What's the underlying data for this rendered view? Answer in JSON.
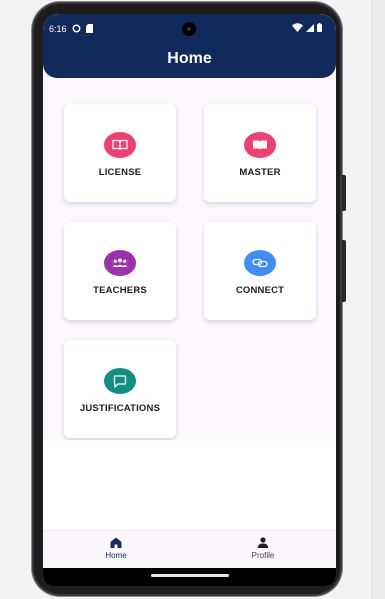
{
  "status_bar": {
    "time": "6:16"
  },
  "app_bar": {
    "title": "Home"
  },
  "cards": [
    {
      "label": "LICENSE",
      "icon": "book-open-icon",
      "color": "#ef3f6f"
    },
    {
      "label": "MASTER",
      "icon": "book-icon",
      "color": "#ef3f6f"
    },
    {
      "label": "TEACHERS",
      "icon": "group-icon",
      "color": "#9b2fae"
    },
    {
      "label": "CONNECT",
      "icon": "link-icon",
      "color": "#3f8ef5"
    },
    {
      "label": "JUSTIFICATIONS",
      "icon": "chat-bubble-icon",
      "color": "#0f8f80"
    }
  ],
  "bottom_nav": {
    "items": [
      {
        "label": "Home",
        "icon": "home-icon",
        "active": true,
        "color": "#172c64"
      },
      {
        "label": "Profile",
        "icon": "person-icon",
        "active": false,
        "color": "#1e1e1e"
      }
    ]
  },
  "colors": {
    "app_bar": "#102a5b",
    "background": "#fcf7fd"
  }
}
